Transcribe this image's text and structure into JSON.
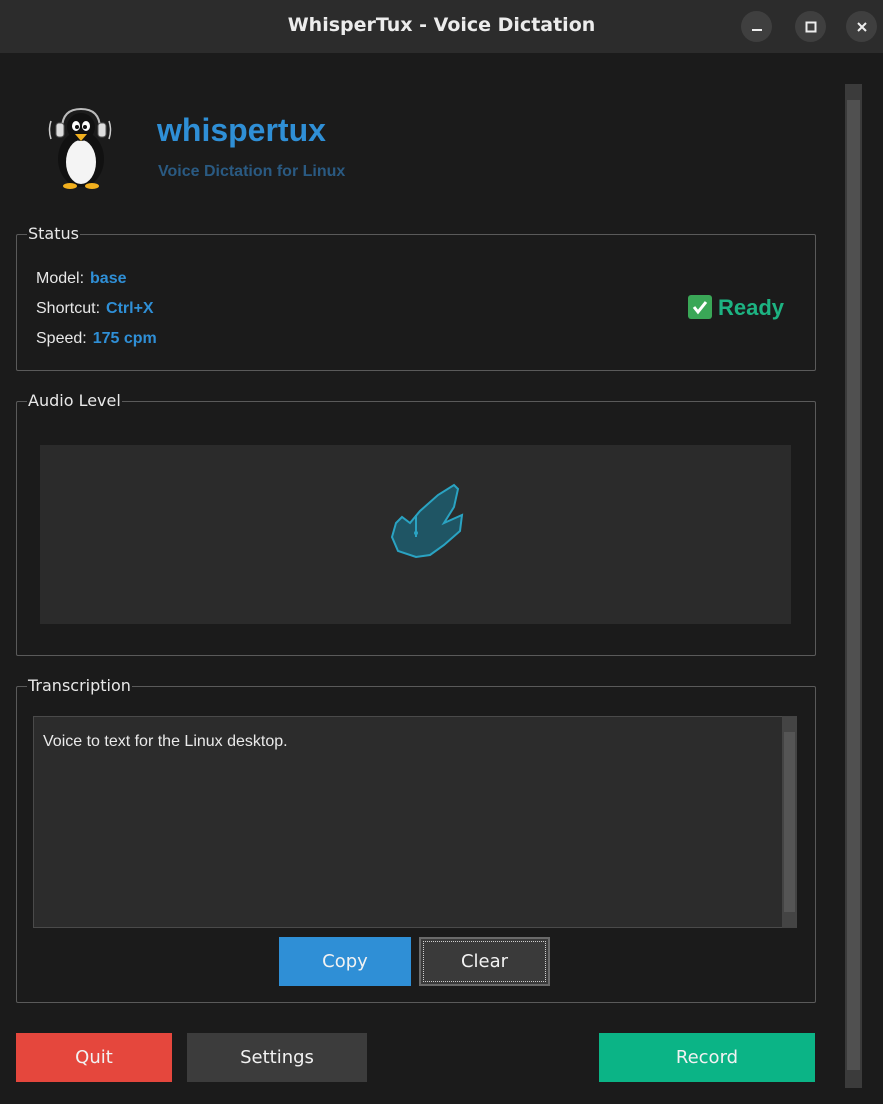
{
  "window": {
    "title": "WhisperTux - Voice Dictation"
  },
  "header": {
    "app_name": "whispertux",
    "subtitle": "Voice Dictation for Linux"
  },
  "status": {
    "group_title": "Status",
    "model_label": "Model:",
    "model_value": "base",
    "shortcut_label": "Shortcut:",
    "shortcut_value": "Ctrl+X",
    "speed_label": "Speed:",
    "speed_value": "175 cpm",
    "state_text": "Ready"
  },
  "audio": {
    "group_title": "Audio Level"
  },
  "transcription": {
    "group_title": "Transcription",
    "text": "Voice to text for the Linux desktop.",
    "copy_label": "Copy",
    "clear_label": "Clear"
  },
  "footer": {
    "quit_label": "Quit",
    "settings_label": "Settings",
    "record_label": "Record"
  },
  "colors": {
    "accent": "#2f8fd6",
    "ready": "#1db382",
    "quit": "#e5473d",
    "record": "#0bb486"
  },
  "icons": {
    "logo": "penguin-headphones-icon",
    "status": "check-mark-icon",
    "audio": "audio-level-icon"
  }
}
